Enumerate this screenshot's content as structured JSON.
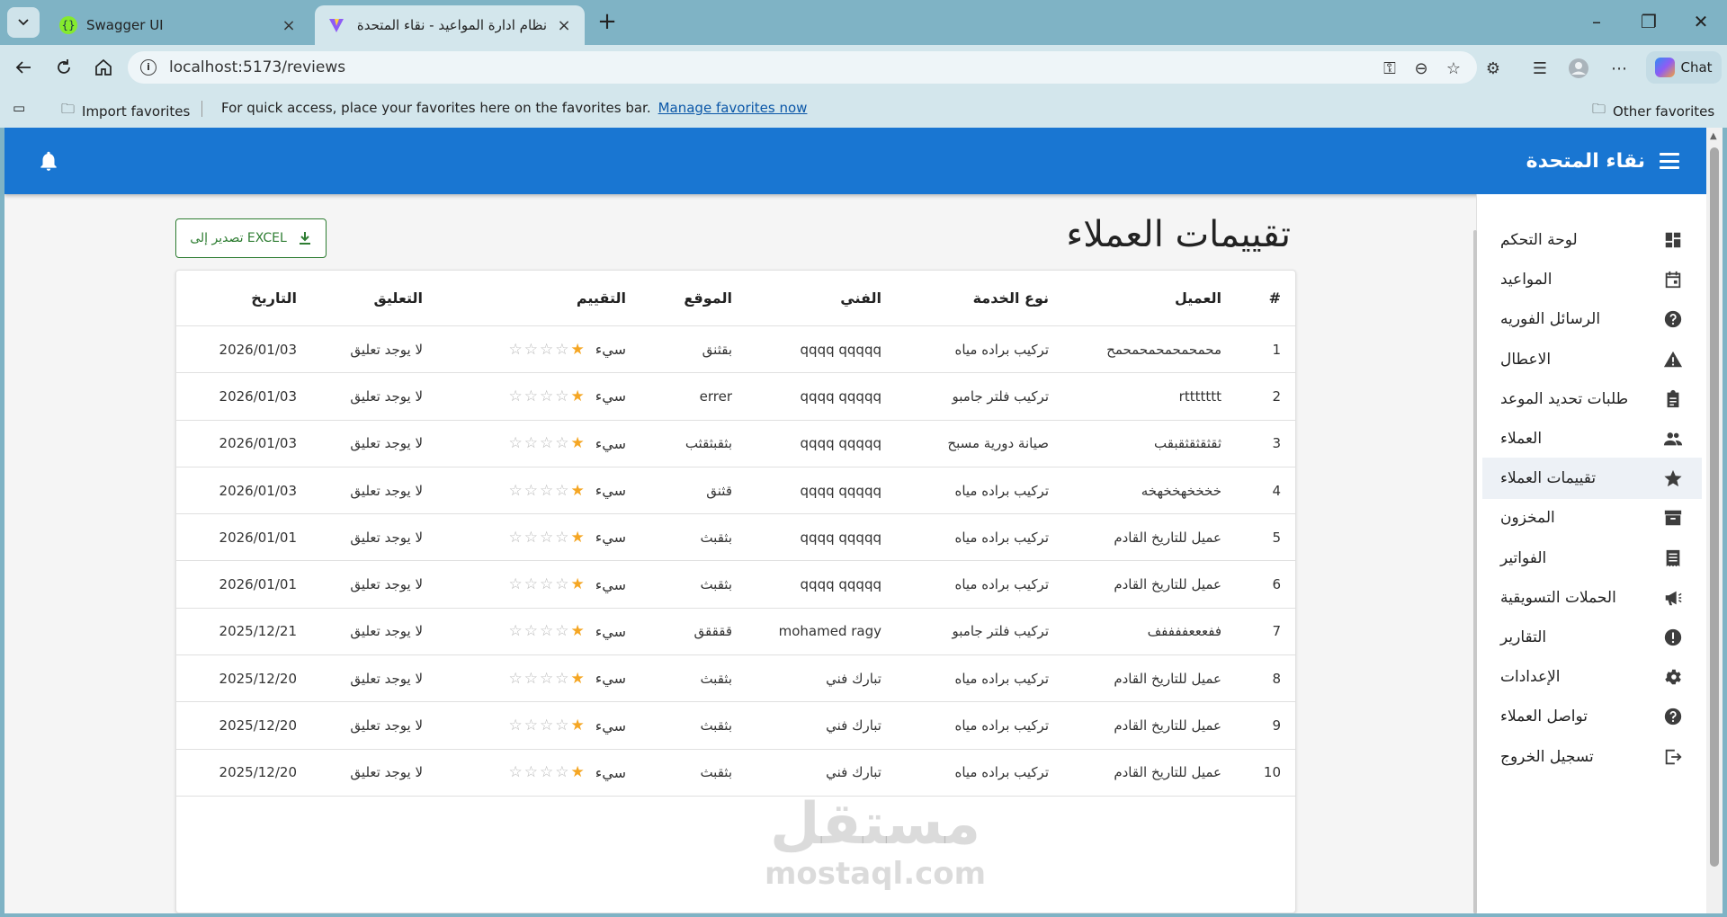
{
  "browser": {
    "tabs": [
      {
        "title": "Swagger UI",
        "active": false
      },
      {
        "title": "نظام ادارة المواعيد - نقاء المتحدة",
        "active": true
      }
    ],
    "url": "localhost:5173/reviews",
    "chat_label": "Chat",
    "favorites": {
      "import_label": "Import favorites",
      "hint": "For quick access, place your favorites here on the favorites bar.",
      "manage_link": "Manage favorites now",
      "other_label": "Other favorites"
    }
  },
  "app": {
    "brand": "نقاء المتحدة",
    "page_title": "تقييمات العملاء",
    "export_label": "تصدير إلى EXCEL"
  },
  "sidebar": {
    "items": [
      {
        "label": "لوحة التحكم",
        "icon": "dashboard-icon"
      },
      {
        "label": "المواعيد",
        "icon": "calendar-icon"
      },
      {
        "label": "الرسائل الفوريه",
        "icon": "help-circle-icon"
      },
      {
        "label": "الاعطال",
        "icon": "warning-icon"
      },
      {
        "label": "طلبات تحديد الموعد",
        "icon": "clipboard-icon"
      },
      {
        "label": "العملاء",
        "icon": "people-icon"
      },
      {
        "label": "تقييمات العملاء",
        "icon": "star-icon",
        "active": true
      },
      {
        "label": "المخزون",
        "icon": "archive-icon"
      },
      {
        "label": "الفواتير",
        "icon": "receipt-icon"
      },
      {
        "label": "الحملات التسويقية",
        "icon": "megaphone-icon"
      },
      {
        "label": "التقارير",
        "icon": "alert-circle-icon"
      },
      {
        "label": "الإعدادات",
        "icon": "gear-icon"
      },
      {
        "label": "تواصل العملاء",
        "icon": "help-circle-icon"
      },
      {
        "label": "تسجيل الخروج",
        "icon": "logout-icon"
      }
    ]
  },
  "table": {
    "headers": {
      "idx": "#",
      "customer": "العميل",
      "service": "نوع الخدمة",
      "technician": "الفني",
      "location": "الموقع",
      "rating": "التقييم",
      "comment": "التعليق",
      "date": "التاريخ"
    },
    "rows": [
      {
        "idx": "1",
        "customer": "محمحمحمحمحمحمح",
        "service": "تركيب براده مياه",
        "technician": "qqqq qqqqq",
        "location": "بقثنق",
        "rating_label": "سيء",
        "rating": 1,
        "comment": "لا يوجد تعليق",
        "date": "2026/01/03"
      },
      {
        "idx": "2",
        "customer": "rttttttt",
        "service": "تركيب فلتر جامبو",
        "technician": "qqqq qqqqq",
        "location": "errer",
        "rating_label": "سيء",
        "rating": 1,
        "comment": "لا يوجد تعليق",
        "date": "2026/01/03"
      },
      {
        "idx": "3",
        "customer": "ثقثقثقثقبقب",
        "service": "صيانة دورية مسبح",
        "technician": "qqqq qqqqq",
        "location": "بثقبثقثب",
        "rating_label": "سيء",
        "rating": 1,
        "comment": "لا يوجد تعليق",
        "date": "2026/01/03"
      },
      {
        "idx": "4",
        "customer": "خخخخهخخهخه",
        "service": "تركيب براده مياه",
        "technician": "qqqq qqqqq",
        "location": "قثنق",
        "rating_label": "سيء",
        "rating": 1,
        "comment": "لا يوجد تعليق",
        "date": "2026/01/03"
      },
      {
        "idx": "5",
        "customer": "عميل للتاريخ القادم",
        "service": "تركيب براده مياه",
        "technician": "qqqq qqqqq",
        "location": "بثقبث",
        "rating_label": "سيء",
        "rating": 1,
        "comment": "لا يوجد تعليق",
        "date": "2026/01/01"
      },
      {
        "idx": "6",
        "customer": "عميل للتاريخ القادم",
        "service": "تركيب براده مياه",
        "technician": "qqqq qqqqq",
        "location": "بثقبث",
        "rating_label": "سيء",
        "rating": 1,
        "comment": "لا يوجد تعليق",
        "date": "2026/01/01"
      },
      {
        "idx": "7",
        "customer": "ففعععففففف",
        "service": "تركيب فلتر جامبو",
        "technician": "mohamed ragy",
        "location": "ققققق",
        "rating_label": "سيء",
        "rating": 1,
        "comment": "لا يوجد تعليق",
        "date": "2025/12/21"
      },
      {
        "idx": "8",
        "customer": "عميل للتاريخ القادم",
        "service": "تركيب براده مياه",
        "technician": "تبارك فني",
        "location": "بثقبث",
        "rating_label": "سيء",
        "rating": 1,
        "comment": "لا يوجد تعليق",
        "date": "2025/12/20"
      },
      {
        "idx": "9",
        "customer": "عميل للتاريخ القادم",
        "service": "تركيب براده مياه",
        "technician": "تبارك فني",
        "location": "بثقبث",
        "rating_label": "سيء",
        "rating": 1,
        "comment": "لا يوجد تعليق",
        "date": "2025/12/20"
      },
      {
        "idx": "10",
        "customer": "عميل للتاريخ القادم",
        "service": "تركيب براده مياه",
        "technician": "تبارك فني",
        "location": "بثقبث",
        "rating_label": "سيء",
        "rating": 1,
        "comment": "لا يوجد تعليق",
        "date": "2025/12/20"
      }
    ],
    "max_stars": 5
  },
  "watermark": {
    "arabic": "مستقل",
    "latin": "mostaql.com"
  },
  "colors": {
    "appbar": "#1976d2",
    "accent_green": "#2e7d32",
    "star": "#f5a623"
  }
}
